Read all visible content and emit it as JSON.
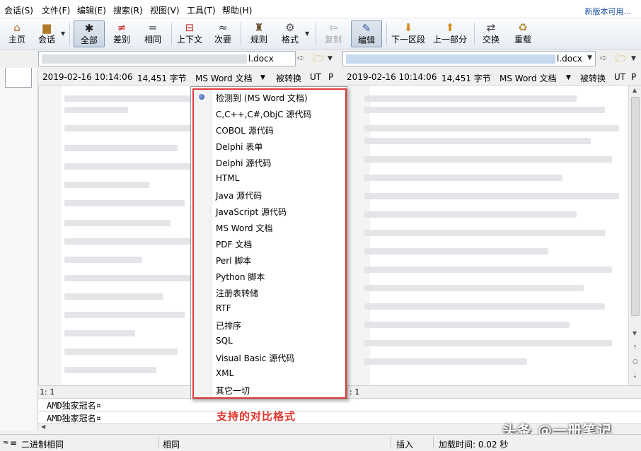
{
  "menubar": {
    "items": [
      "会话(S)",
      "文件(F)",
      "编辑(E)",
      "搜索(R)",
      "视图(V)",
      "工具(T)",
      "帮助(H)"
    ],
    "notice": "新版本可用..."
  },
  "toolbar": {
    "home": "主页",
    "session": "会话",
    "all": "全部",
    "diff": "差别",
    "same": "相同",
    "context": "上下文",
    "minor": "次要",
    "rules": "规则",
    "format": "格式",
    "copy": "复制",
    "edit": "编辑",
    "next_section": "下一区段",
    "prev_part": "上一部分",
    "swap": "交换",
    "reload": "重载"
  },
  "left_file": {
    "name": "l.docx",
    "date": "2019-02-16 10:14:06",
    "size": "14,451 字节",
    "format": "MS Word 文档",
    "conversion": "被转换",
    "encoding": "UT",
    "p": "P"
  },
  "right_file": {
    "name": "l.docx",
    "date": "2019-02-16 10:14:06",
    "size": "14,451 字节",
    "format": "MS Word 文档",
    "conversion": "被转换",
    "encoding": "UT",
    "p": "P"
  },
  "format_menu": {
    "items": [
      "检测到 (MS Word 文档)",
      "C,C++,C#,ObjC 源代码",
      "COBOL 源代码",
      "Delphi 表单",
      "Delphi 源代码",
      "HTML",
      "Java 源代码",
      "JavaScript 源代码",
      "MS Word 文档",
      "PDF 文档",
      "Perl 脚本",
      "Python 脚本",
      "注册表转储",
      "RTF",
      "已排序",
      "SQL",
      "Visual Basic 源代码",
      "XML",
      "其它一切"
    ],
    "selected_index": 0
  },
  "position": {
    "left": "1: 1",
    "right": ": 1"
  },
  "line_view": {
    "line1": "AMD独家冠名¤",
    "line2": "AMD独家冠名¤"
  },
  "annotation": "支持的对比格式",
  "watermark": "头条 @一册笔记",
  "status": {
    "binary": "二进制相同",
    "same": "相同",
    "insert": "插入",
    "load_time": "加载时间: 0.02 秒"
  }
}
